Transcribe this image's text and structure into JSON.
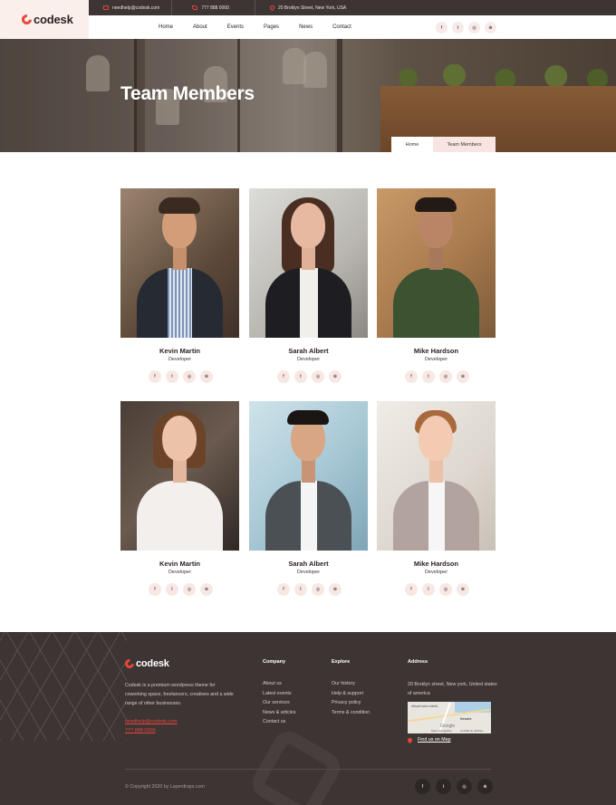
{
  "brand": {
    "name": "codesk"
  },
  "topbar": {
    "email": "needhelp@codesk.com",
    "phone": "777 888 0000",
    "address": "20 Broklyn Street, New York, USA"
  },
  "nav": [
    "Home",
    "About",
    "Events",
    "Pages",
    "News",
    "Contact"
  ],
  "social_icons": [
    "facebook-icon",
    "twitter-icon",
    "instagram-icon",
    "dribbble-icon"
  ],
  "social_glyphs": [
    "f",
    "t",
    "◎",
    "⊕"
  ],
  "hero": {
    "title": "Team Members",
    "breadcrumb": [
      "Home",
      "Team Members"
    ]
  },
  "team": [
    {
      "name": "Kevin Martin",
      "role": "Developer"
    },
    {
      "name": "Sarah Albert",
      "role": "Developer"
    },
    {
      "name": "Mike Hardson",
      "role": "Developer"
    },
    {
      "name": "Kevin Martin",
      "role": "Developer"
    },
    {
      "name": "Sarah Albert",
      "role": "Developer"
    },
    {
      "name": "Mike Hardson",
      "role": "Developer"
    }
  ],
  "footer": {
    "about": "Codesk is a premium wordpress theme for coworking space, freelancers, creatives and a wide range of other businesses.",
    "email": "needhelp@codesk.com",
    "phone": "777 888 0000",
    "company": {
      "heading": "Company",
      "links": [
        "About us",
        "Latest events",
        "Our services",
        "News & articles",
        "Contact us"
      ]
    },
    "explore": {
      "heading": "Explore",
      "links": [
        "Our history",
        "Help & support",
        "Privacy policy",
        "Terms & condition"
      ]
    },
    "address": {
      "heading": "Address",
      "text": "20 Broklyn street, New york, United states of america",
      "map_link": "Find us on Map"
    },
    "map_labels": [
      "Afişați harta mărită",
      "Newark",
      "Google",
      "Date cartografice",
      "Condiții de utilizare"
    ],
    "copyright": "© Copyright 2020 by Layerdrops.com"
  },
  "colors": {
    "accent": "#e8463b",
    "dark": "#3d3534",
    "soft_pink": "#f8e5e1"
  }
}
